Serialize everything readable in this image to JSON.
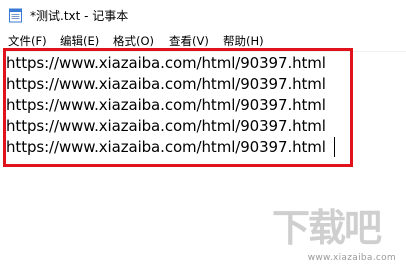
{
  "window": {
    "title": "*测试.txt - 记事本"
  },
  "menu": {
    "items": [
      {
        "label": "文件(F)"
      },
      {
        "label": "编辑(E)"
      },
      {
        "label": "格式(O)"
      },
      {
        "label": "查看(V)"
      },
      {
        "label": "帮助(H)"
      }
    ]
  },
  "editor": {
    "lines": [
      "https://www.xiazaiba.com/html/90397.html",
      "https://www.xiazaiba.com/html/90397.html",
      "https://www.xiazaiba.com/html/90397.html",
      "https://www.xiazaiba.com/html/90397.html",
      "https://www.xiazaiba.com/html/90397.html"
    ]
  },
  "watermark": {
    "logo_text": "下载吧",
    "url": "www.xiazaiba.com"
  },
  "colors": {
    "highlight_border": "#e0121b",
    "watermark": "#c8c8c8"
  }
}
